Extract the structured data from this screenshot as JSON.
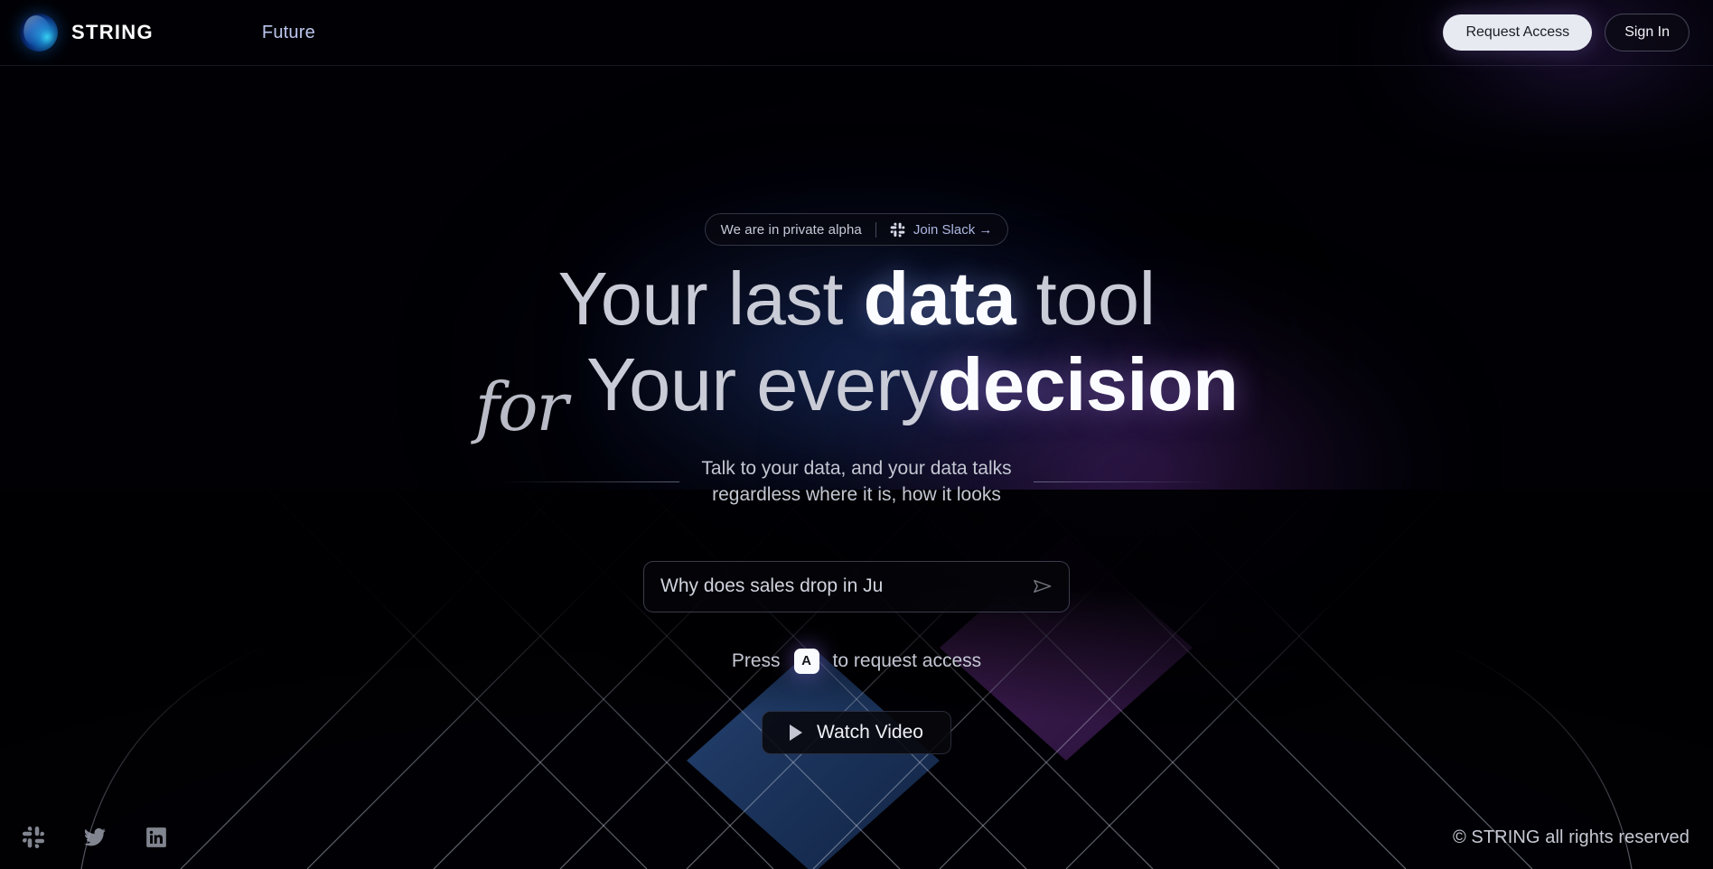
{
  "header": {
    "brand_name": "STRING",
    "logo_icon": "string-sphere-logo",
    "nav": [
      {
        "label": "Future",
        "icon": ""
      }
    ],
    "request_access_label": "Request Access",
    "sign_in_label": "Sign In"
  },
  "hero": {
    "badge": {
      "text": "We are in private alpha",
      "slack_icon": "slack-icon",
      "link_label": "Join Slack →"
    },
    "headline": {
      "line1_part1": "Your last ",
      "line1_bold": "data",
      "line1_part2": " tool",
      "line2_script": "for",
      "line2_part1": "Your every ",
      "line2_bold": "decision"
    },
    "subtitle_line1": "Talk to your data, and your data talks",
    "subtitle_line2": "regardless where it is, how it looks",
    "prompt": {
      "value": "Why does sales drop in Ju",
      "placeholder": "Why does sales drop in Ju",
      "send_icon": "send-icon"
    },
    "press_prefix": "Press",
    "press_key": "A",
    "press_suffix": "to request access",
    "watch_video_label": "Watch Video",
    "watch_video_icon": "play-icon"
  },
  "footer": {
    "socials": [
      {
        "name": "slack-icon"
      },
      {
        "name": "twitter-icon"
      },
      {
        "name": "linkedin-icon"
      }
    ],
    "copyright": "© STRING all rights reserved"
  },
  "colors": {
    "background": "#010105",
    "accent_blue": "#1e78dc",
    "accent_purple": "#622e8c",
    "text_primary": "#fbfcff",
    "text_muted": "#c3c7d2",
    "nav_link": "#bcc6ee",
    "button_light_bg": "#e8eaf2"
  }
}
